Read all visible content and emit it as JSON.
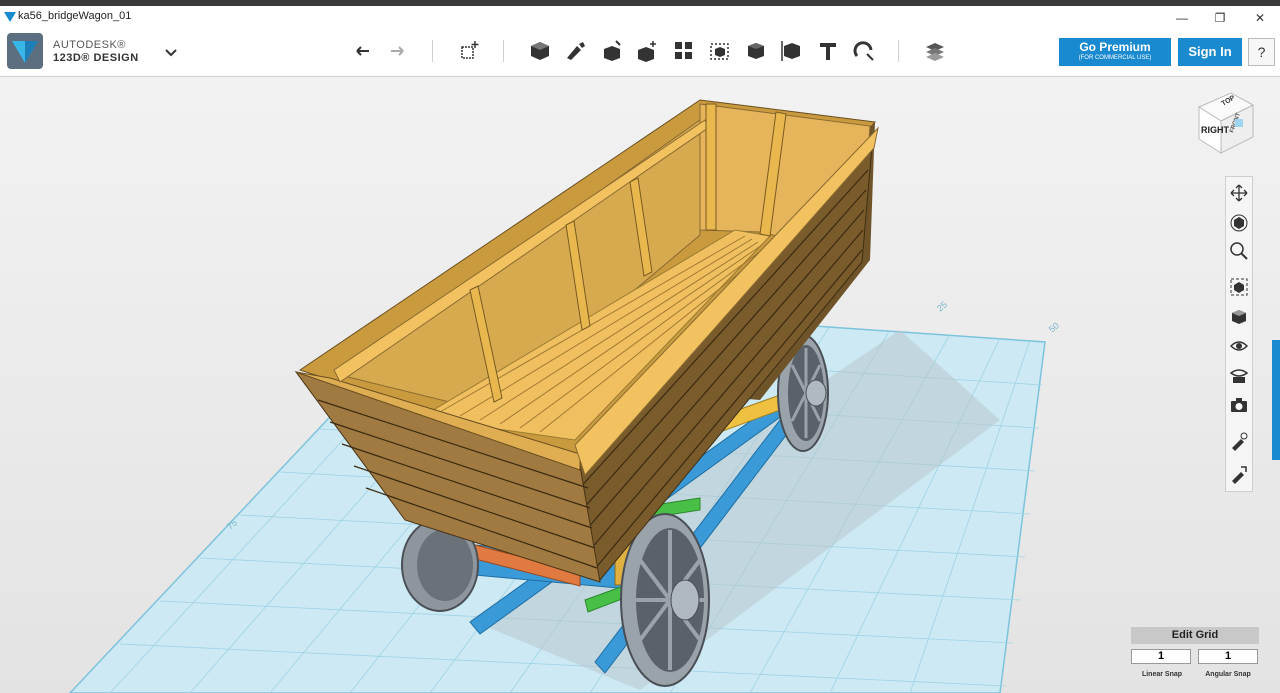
{
  "window": {
    "title": "ka56_bridgeWagon_01",
    "minimize_glyph": "—",
    "restore_glyph": "❐",
    "close_glyph": "✕"
  },
  "app": {
    "brand_top": "AUTODESK®",
    "brand_bottom": "123D® DESIGN"
  },
  "toolbar": {
    "tools": [
      "undo-icon",
      "redo-icon",
      "transform-icon",
      "primitives-icon",
      "sketch-icon",
      "construct-icon",
      "modify-icon",
      "pattern-icon",
      "group-icon",
      "combine-icon",
      "measure-icon",
      "text-icon",
      "snap-icon",
      "material-icon"
    ]
  },
  "account": {
    "premium_label": "Go Premium",
    "premium_sub": "(FOR COMMERCIAL USE)",
    "signin_label": "Sign In",
    "help_label": "?"
  },
  "viewcube": {
    "face_label": "RIGHT",
    "top_label": "TOP",
    "front_label": "FRONT"
  },
  "grid_labels": {
    "near_left": "75",
    "mid_right": "25",
    "far_right": "50"
  },
  "navbar": {
    "items": [
      "pan-icon",
      "orbit-icon",
      "zoom-icon",
      "fit-icon",
      "view-icon",
      "visibility-icon",
      "materials-outlines-icon",
      "screenshot-icon",
      "physical-material-icon",
      "heatmap-icon"
    ]
  },
  "grid": {
    "edit_label": "Edit Grid",
    "linear_snap_value": "1",
    "angular_snap_value": "1",
    "linear_label": "Linear Snap",
    "angular_label": "Angular Snap"
  },
  "colors": {
    "accent": "#1a8ad0",
    "wood_light": "#f0c060",
    "wood_dark": "#8a6a30",
    "frame_blue": "#3a9ad8",
    "wheel_gray": "#9aa2aa",
    "green_beam": "#48c048",
    "orange_beam": "#e07a40"
  }
}
